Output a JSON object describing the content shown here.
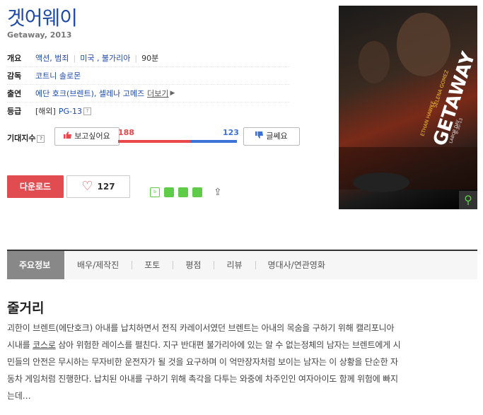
{
  "movie": {
    "title": "겟어웨이",
    "subtitle": "Getaway, 2013",
    "info": {
      "overview_label": "개요",
      "genre": "액션, 범죄",
      "country": "미국 , 불가리아",
      "runtime": "90분",
      "director_label": "감독",
      "director": "코트니 솔로몬",
      "cast_label": "출연",
      "cast": "에단 호크(브렌트), 셀레나 고메즈",
      "cast_more": "더보기",
      "rating_label": "등급",
      "rating_prefix": "[해외]",
      "rating": "PG-13"
    },
    "expect": {
      "label": "기대지수",
      "want_button": "보고싶어요",
      "nah_button": "글쎄요",
      "want_count": "188",
      "nah_count": "123",
      "want_ratio": 0.6045
    },
    "actions": {
      "download_button": "다운로드",
      "like_count": "127"
    },
    "tabs": [
      "주요정보",
      "배우/제작진",
      "포토",
      "평점",
      "리뷰",
      "명대사/연관영화"
    ],
    "synopsis": {
      "title": "줄거리",
      "line1": "괴한이 브렌트(에단호크) 아내를 납치하면서 전직 카레이서였던 브렌트는 아내의 목숨을 구하기 위해 캘리포니아",
      "line2a": "시내를 ",
      "line2u": "코스로",
      "line2b": " 삼아 위험한 레이스를 펼친다. 지구 반대편 불가리아에 있는 알 수 없는정체의 남자는 브렌트에게 시",
      "line3": "민들의 안전은 무시하는 무자비한 운전자가 될 것을 요구하며 이 억만장자처럼 보이는 남자는 이 상황을 단순한 자",
      "line4": "동차 게임처럼 진행한다. 납치된 아내를 구하기 위해 촉각을 다투는 와중에 차주인인 여자아이도 함께 위험에 빠지",
      "line5": "는데…"
    },
    "poster": {
      "title_text": "GETAWAY",
      "actor1": "ETHAN HAWKE",
      "actor2": "SELENA GOMEZ",
      "tagline": "LABOR DAY",
      "date": "8-30-13"
    },
    "colors": {
      "title_blue": "#1f4aa8",
      "want_red": "#e8474c",
      "nah_blue": "#3c72d6",
      "download_red": "#e14c50"
    }
  }
}
